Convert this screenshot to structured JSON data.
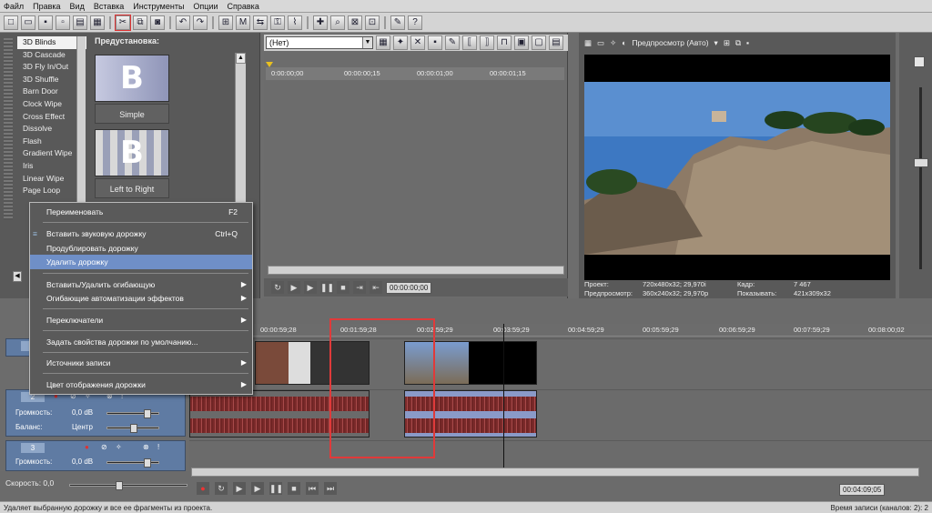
{
  "menubar": {
    "items": [
      "Файл",
      "Правка",
      "Вид",
      "Вставка",
      "Инструменты",
      "Опции",
      "Справка"
    ]
  },
  "toolbar": {
    "icons": [
      "new-icon",
      "open-icon",
      "save-icon",
      "save-as-icon",
      "render-icon",
      "properties-icon",
      "cut-icon",
      "copy-icon",
      "paste-icon",
      "undo-icon",
      "redo-icon",
      "snap-icon",
      "marker-icon",
      "ripple-icon",
      "lock-icon",
      "envelope-icon",
      "select-icon",
      "zoom-icon",
      "split-icon",
      "trim-icon",
      "help-icon"
    ]
  },
  "effects": {
    "items": [
      "3D Blinds",
      "3D Cascade",
      "3D Fly In/Out",
      "3D Shuffle",
      "Barn Door",
      "Clock Wipe",
      "Cross Effect",
      "Dissolve",
      "Flash",
      "Gradient Wipe",
      "Iris",
      "Linear Wipe",
      "Page Loop"
    ],
    "selected": "3D Blinds",
    "preset_title": "Предустановка:",
    "presets": [
      {
        "glyph": "B",
        "label": "Simple"
      },
      {
        "glyph": "B",
        "label": "Left to Right"
      }
    ]
  },
  "trimmer": {
    "dropdown_value": "(Нет)",
    "ruler_ticks": [
      "0:00:00;00",
      "00:00:00;15",
      "00:00:01;00",
      "00:00:01;15"
    ],
    "timecode": "00:00:00;00"
  },
  "preview": {
    "mode_label": "Предпросмотр (Авто)",
    "info": {
      "project_label": "Проект:",
      "project_value": "720x480x32; 29,970i",
      "preview_label": "Предпросмотр:",
      "preview_value": "360x240x32; 29,970p",
      "frame_label": "Кадр:",
      "frame_value": "7 467",
      "display_label": "Показывать:",
      "display_value": "421x309x32"
    }
  },
  "context_menu": {
    "items": [
      {
        "label": "Переименовать",
        "shortcut": "F2"
      },
      {
        "label": "Вставить звуковую дорожку",
        "shortcut": "Ctrl+Q"
      },
      {
        "label": "Продублировать дорожку",
        "shortcut": ""
      },
      {
        "label": "Удалить дорожку",
        "shortcut": "",
        "highlighted": true
      },
      {
        "label": "Вставить/Удалить огибающую",
        "submenu": true
      },
      {
        "label": "Огибающие автоматизации эффектов",
        "submenu": true
      },
      {
        "label": "Переключатели",
        "submenu": true
      },
      {
        "label": "Задать свойства дорожки по умолчанию...",
        "submenu": false
      },
      {
        "label": "Источники записи",
        "submenu": true
      },
      {
        "label": "Цвет отображения дорожки",
        "submenu": true
      }
    ]
  },
  "timeline": {
    "ruler_ticks": [
      "00:00:59;28",
      "00:01:59;28",
      "00:02:59;29",
      "00:03:59;29",
      "00:04:59;29",
      "00:05:59;29",
      "00:06:59;29",
      "00:07:59;29",
      "00:08:00;02",
      "00:09:00;02"
    ],
    "tracks": [
      {
        "num": "1"
      },
      {
        "num": "2",
        "volume_label": "Громкость:",
        "volume_value": "0,0 dB",
        "pan_label": "Баланс:",
        "pan_value": "Центр"
      },
      {
        "num": "3",
        "volume_label": "Громкость:",
        "volume_value": "0,0 dB"
      }
    ],
    "speed_label": "Скорость: 0,0",
    "end_timecode": "00:04:09;05"
  },
  "status": {
    "left": "Удаляет выбранную дорожку и все ее фрагменты из проекта.",
    "right": "Время записи (каналов: 2): 2"
  },
  "colors": {
    "highlight": "#6f8fc7",
    "track_header": "#5f7ba3",
    "red_annotation": "#e03a3a"
  }
}
